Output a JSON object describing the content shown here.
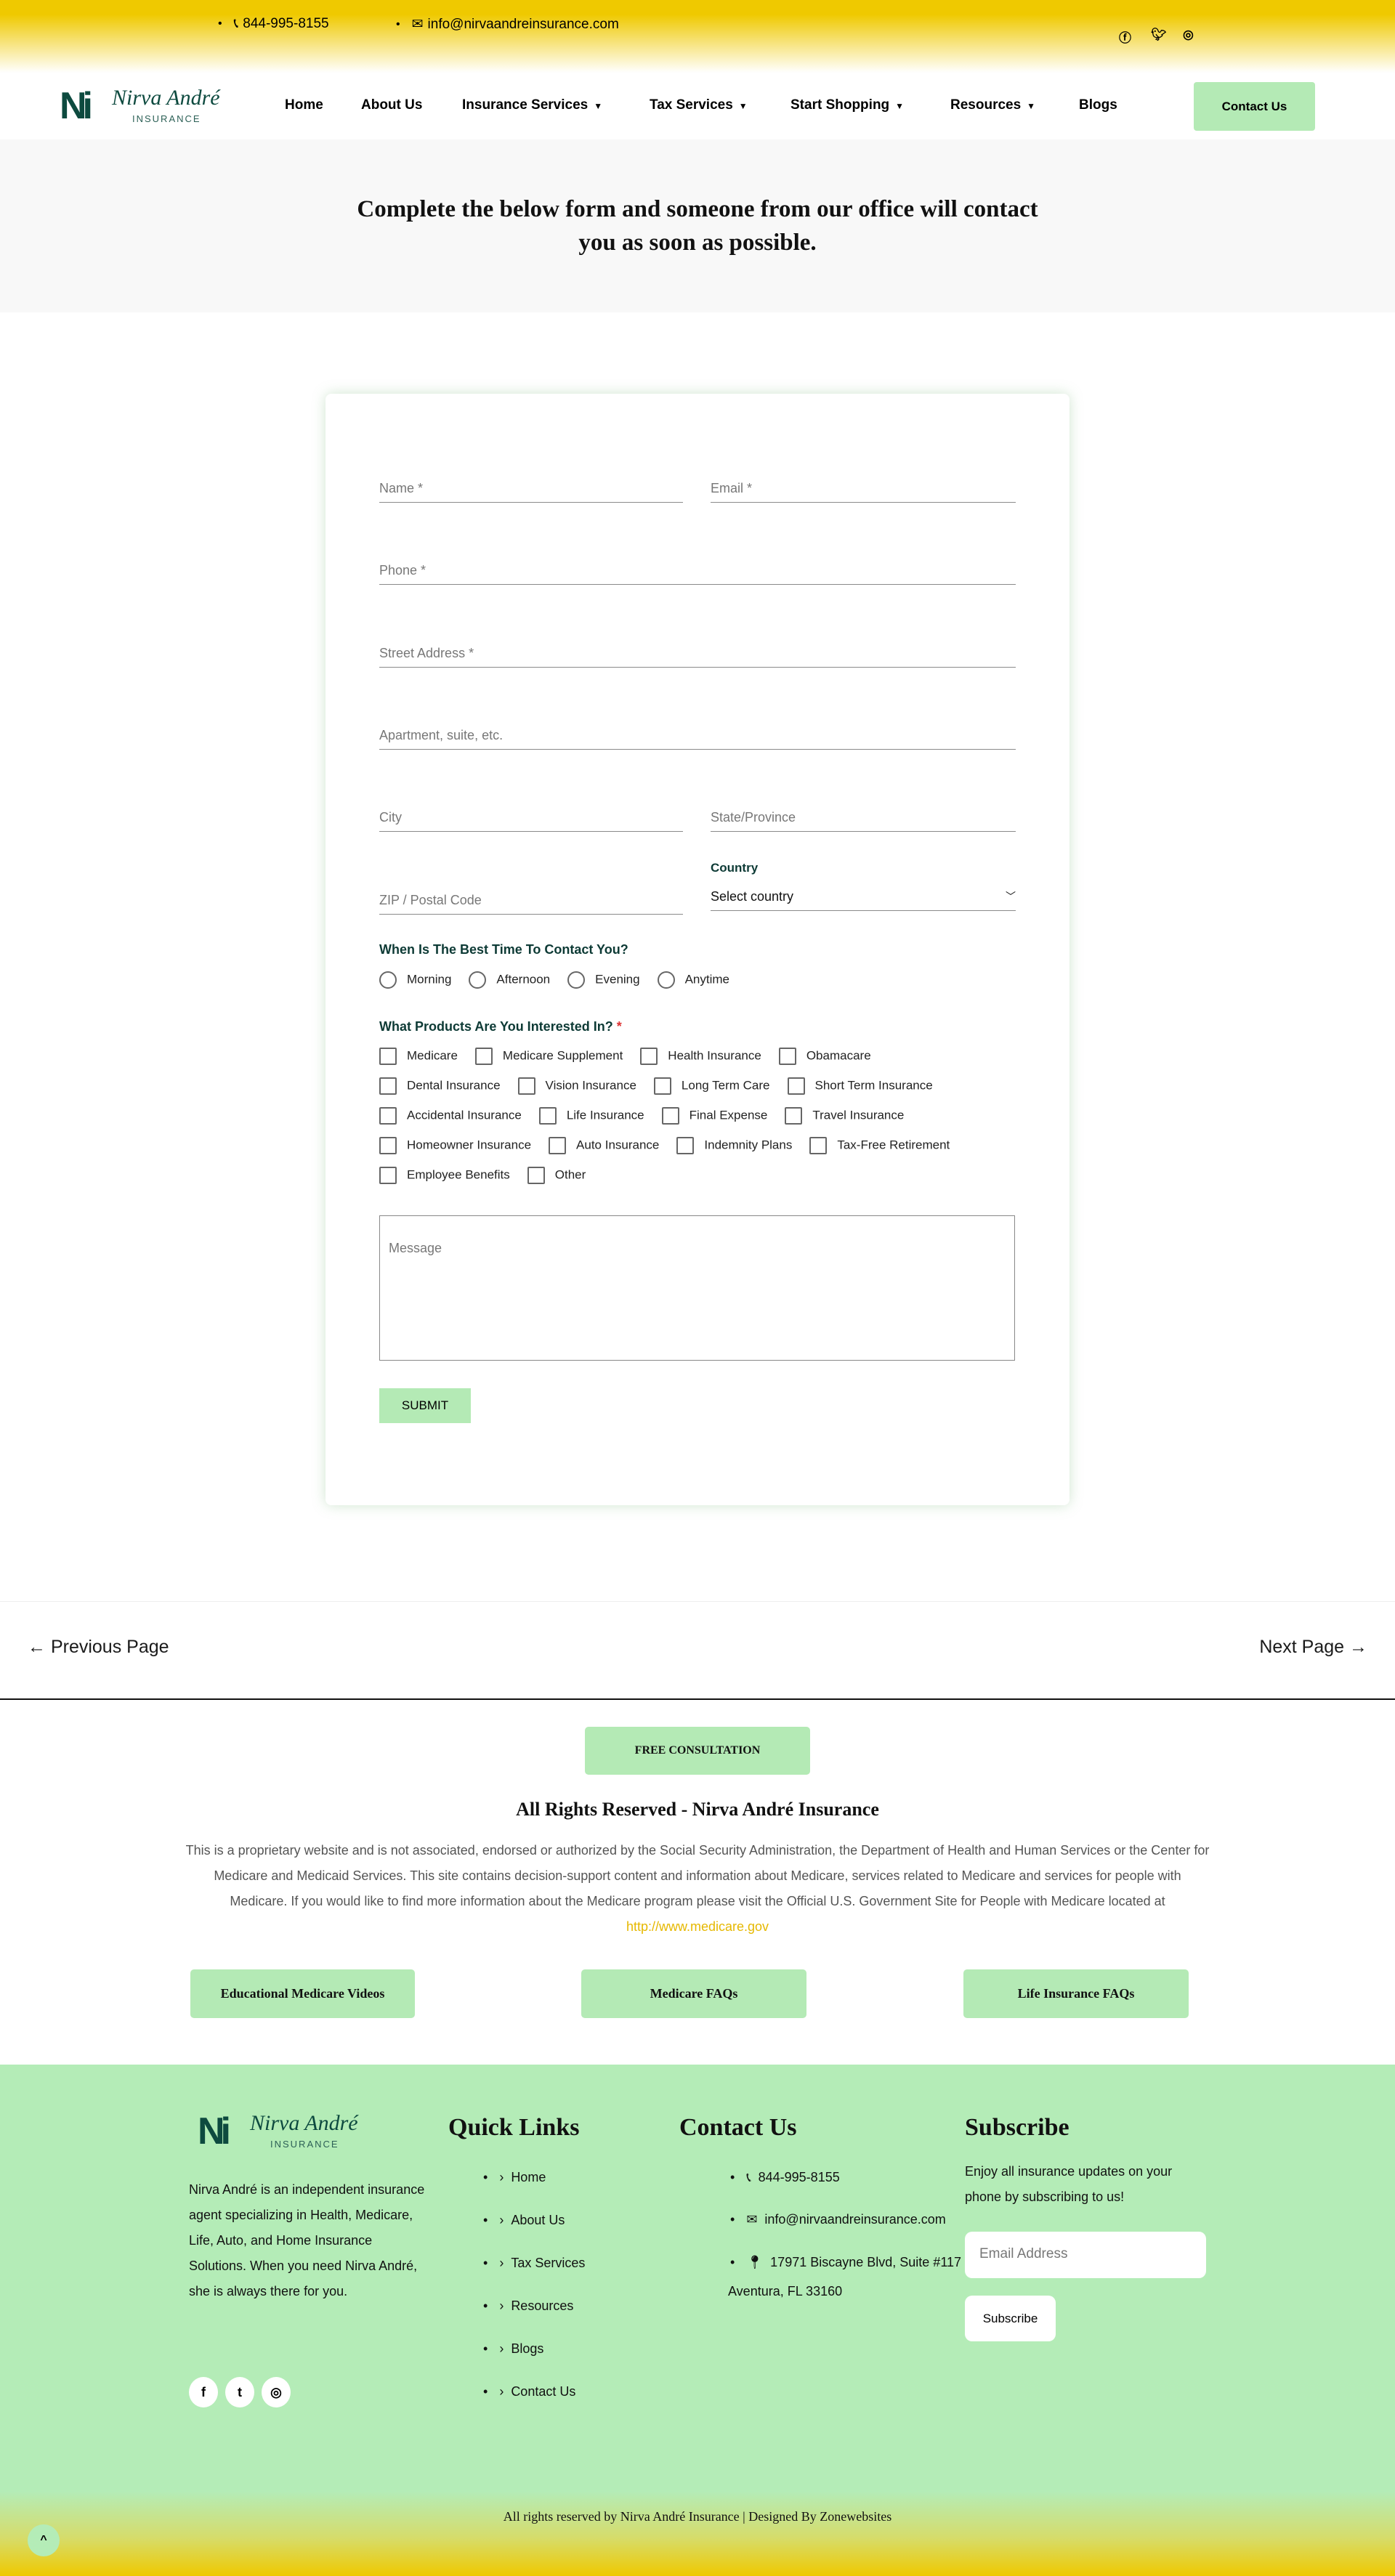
{
  "topbar": {
    "phone": "844-995-8155",
    "email": "info@nirvaandreinsurance.com",
    "social": [
      "facebook-icon",
      "twitter-icon",
      "instagram-icon"
    ]
  },
  "brand": {
    "logo_mark": "Ni",
    "logo_name": "Nirva André",
    "logo_sub": "INSURANCE"
  },
  "nav": {
    "items": [
      {
        "label": "Home"
      },
      {
        "label": "About Us"
      },
      {
        "label": "Insurance Services",
        "dropdown": true
      },
      {
        "label": "Tax Services",
        "dropdown": true
      },
      {
        "label": "Start Shopping",
        "dropdown": true
      },
      {
        "label": "Resources",
        "dropdown": true
      },
      {
        "label": "Blogs"
      }
    ],
    "cta": "Contact Us"
  },
  "hero": {
    "text": "Complete the below form and someone from our office will contact you as soon as possible."
  },
  "form": {
    "name_ph": "Name *",
    "email_ph": "Email *",
    "phone_ph": "Phone *",
    "street_ph": "Street Address *",
    "apt_ph": "Apartment, suite, etc.",
    "city_ph": "City",
    "state_ph": "State/Province",
    "zip_ph": "ZIP / Postal Code",
    "country_label": "Country",
    "country_value": "Select country",
    "time_label": "When Is The Best Time To Contact You?",
    "time_options": [
      "Morning",
      "Afternoon",
      "Evening",
      "Anytime"
    ],
    "products_label": "What Products Are You Interested In?",
    "required_mark": "*",
    "product_rows": [
      [
        "Medicare",
        "Medicare Supplement",
        "Health Insurance",
        "Obamacare"
      ],
      [
        "Dental Insurance",
        "Vision Insurance",
        "Long Term Care",
        "Short Term Insurance"
      ],
      [
        "Accidental Insurance",
        "Life Insurance",
        "Final Expense",
        "Travel Insurance"
      ],
      [
        "Homeowner Insurance",
        "Auto Insurance",
        "Indemnity Plans",
        "Tax-Free Retirement"
      ],
      [
        "Employee Benefits",
        "Other"
      ]
    ],
    "message_ph": "Message",
    "submit": "SUBMIT"
  },
  "pagination": {
    "prev": "← Previous Page",
    "next": "Next Page →"
  },
  "disclaimer": {
    "cta": "FREE CONSULTATION",
    "title": "All Rights Reserved - Nirva André Insurance",
    "text": "This is a proprietary website and is not associated, endorsed or authorized by the Social Security Administration, the Department of Health and Human Services or the Center for Medicare and Medicaid Services. This site contains decision-support content and information about Medicare, services related to Medicare and services for people with Medicare. If you would like to find more information about the Medicare program please visit the Official U.S. Government Site for People with Medicare located at ",
    "link": "http://www.medicare.gov",
    "buttons": [
      "Educational Medicare Videos",
      "Medicare FAQs",
      "Life Insurance FAQs"
    ]
  },
  "footer": {
    "about": "Nirva André is an independent insurance agent specializing in Health, Medicare, Life, Auto, and Home Insurance Solutions. When you need Nirva André, she is always there for you.",
    "quick_title": "Quick Links",
    "quick_links": [
      "Home",
      "About Us",
      "Tax Services",
      "Resources",
      "Blogs",
      "Contact Us"
    ],
    "contact_title": "Contact Us",
    "phone": "844-995-8155",
    "email": "info@nirvaandreinsurance.com",
    "address1": "17971 Biscayne Blvd, Suite #117",
    "address2": "Aventura, FL 33160",
    "sub_title": "Subscribe",
    "sub_text": "Enjoy all insurance updates on your phone by subscribing to us!",
    "sub_ph": "Email Address",
    "sub_btn": "Subscribe",
    "copyright": "All rights reserved by Nirva André Insurance | Designed By Zonewebsites"
  },
  "colors": {
    "accent_green": "#b4eab5",
    "brand_yellow": "#efc900",
    "brand_dark": "#0d4a3f",
    "link": "#e6b800"
  }
}
